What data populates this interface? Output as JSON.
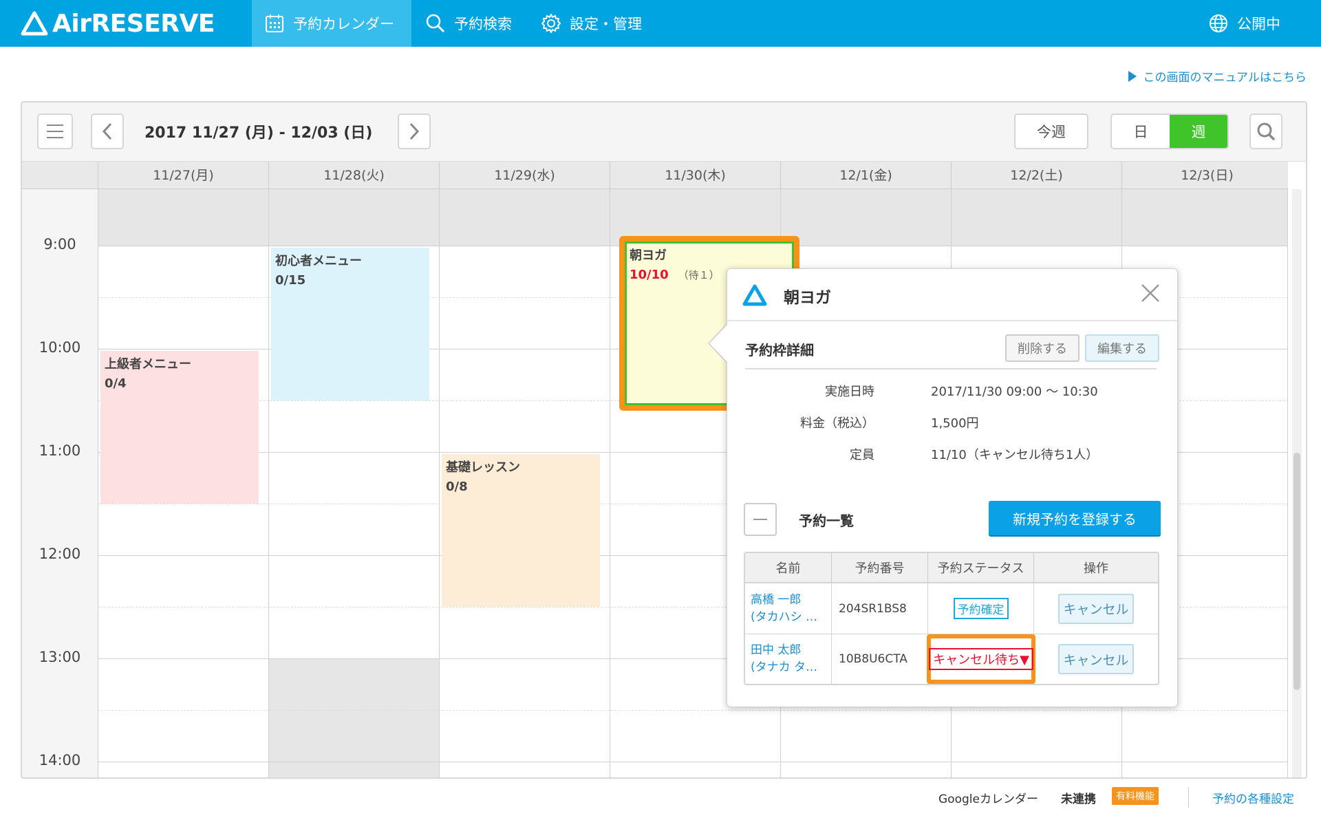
{
  "header": {
    "logo_text": "AirRESERVE",
    "nav": [
      {
        "label": "予約カレンダー",
        "icon": "calendar-icon"
      },
      {
        "label": "予約検索",
        "icon": "search-icon"
      },
      {
        "label": "設定・管理",
        "icon": "gear-icon"
      }
    ],
    "public_label": "公開中",
    "public_icon": "globe-icon"
  },
  "manual_link": "この画面のマニュアルはこちら",
  "toolbar": {
    "date_range": "2017 11/27 (月) - 12/03 (日)",
    "this_week": "今週",
    "view_day": "日",
    "view_week": "週"
  },
  "days": [
    "11/27(月)",
    "11/28(火)",
    "11/29(水)",
    "11/30(木)",
    "12/1(金)",
    "12/2(土)",
    "12/3(日)"
  ],
  "times": [
    "9:00",
    "10:00",
    "11:00",
    "12:00",
    "13:00",
    "14:00"
  ],
  "events": [
    {
      "title": "上級者メニュー",
      "count": "0/4"
    },
    {
      "title": "初心者メニュー",
      "count": "0/15"
    },
    {
      "title": "基礎レッスン",
      "count": "0/8"
    },
    {
      "title": "朝ヨガ",
      "count": "10/10",
      "note": "（待１）"
    }
  ],
  "popup": {
    "title": "朝ヨガ",
    "section": "予約枠詳細",
    "delete_label": "削除する",
    "edit_label": "編集する",
    "details": [
      {
        "key": "実施日時",
        "value": "2017/11/30 09:00 ～ 10:30"
      },
      {
        "key": "料金（税込）",
        "value": "1,500円"
      },
      {
        "key": "定員",
        "value": "11/10（キャンセル待ち1人）"
      }
    ],
    "list_title": "予約一覧",
    "new_reservation_label": "新規予約を登録する",
    "table_headers": [
      "名前",
      "予約番号",
      "予約ステータス",
      "操作"
    ],
    "rows": [
      {
        "name1": "高橋 一郎",
        "name2": "(タカハシ …",
        "number": "204SR1BS8",
        "status": "予約確定",
        "action": "キャンセル"
      },
      {
        "name1": "田中 太郎",
        "name2": "(タナカ タ…",
        "number": "10B8U6CTA",
        "status": "キャンセル待ち▼",
        "action": "キャンセル"
      }
    ]
  },
  "footer": {
    "google_label": "Googleカレンダー",
    "google_status": "未連携",
    "paid_badge": "有料機能",
    "settings_link": "予約の各種設定"
  },
  "colors": {
    "header_bg": "#00a4e1",
    "accent_green": "#3fc42a",
    "highlight_orange": "#f7921c",
    "alert_red": "#e8102d"
  }
}
